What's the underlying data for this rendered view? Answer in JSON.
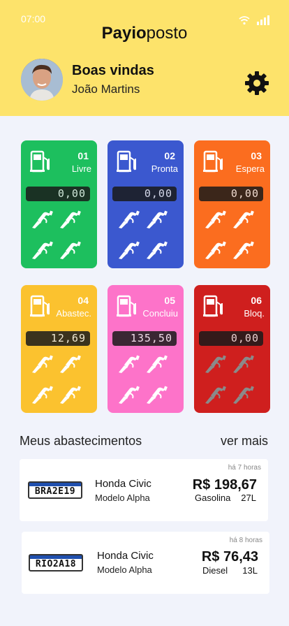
{
  "status_bar": {
    "time": "07:00"
  },
  "header": {
    "brand_bold": "Payio",
    "brand_light": "posto",
    "welcome": "Boas vindas",
    "user_name": "João Martins"
  },
  "pumps": [
    {
      "number": "01",
      "status": "Livre",
      "display": "0,00",
      "color": "#1dbf5e",
      "nozzle_color": "#ffffff"
    },
    {
      "number": "02",
      "status": "Pronta",
      "display": "0,00",
      "color": "#3b58cf",
      "nozzle_color": "#ffffff"
    },
    {
      "number": "03",
      "status": "Espera",
      "display": "0,00",
      "color": "#fb6d1f",
      "nozzle_color": "#ffffff"
    },
    {
      "number": "04",
      "status": "Abastec.",
      "display": "12,69",
      "color": "#fbc22f",
      "nozzle_color": "#ffffff"
    },
    {
      "number": "05",
      "status": "Concluiu",
      "display": "135,50",
      "color": "#fd73c9",
      "nozzle_color": "#ffffff"
    },
    {
      "number": "06",
      "status": "Bloq.",
      "display": "0,00",
      "color": "#cf1f1e",
      "nozzle_color": "#8a8a8a"
    }
  ],
  "history": {
    "title": "Meus abastecimentos",
    "see_more": "ver mais",
    "items": [
      {
        "time_ago": "há 7 horas",
        "plate": "BRA2E19",
        "model": "Honda Civic",
        "variant": "Modelo Alpha",
        "price": "R$ 198,67",
        "fuel": "Gasolina",
        "liters": "27L"
      },
      {
        "time_ago": "há 8 horas",
        "plate": "RIO2A18",
        "model": "Honda Civic",
        "variant": "Modelo Alpha",
        "price": "R$ 76,43",
        "fuel": "Diesel",
        "liters": "13L"
      }
    ]
  },
  "icons": {
    "settings": "gear-icon",
    "pump": "fuel-pump-icon",
    "nozzle": "fuel-nozzle-icon",
    "wifi": "wifi-icon",
    "signal": "signal-icon"
  }
}
